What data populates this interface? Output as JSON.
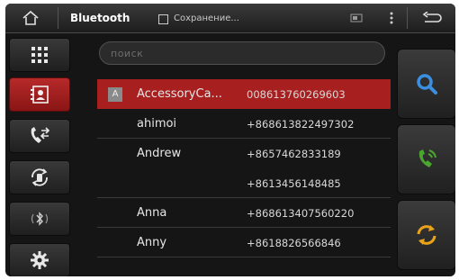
{
  "statusbar": {
    "title": "Bluetooth",
    "notification": "Сохранение..."
  },
  "icons": {
    "home": "home-icon",
    "notification": "save-icon",
    "sd": "sd-card-icon",
    "menu": "menu-dots-icon",
    "back": "back-icon"
  },
  "sidebar": {
    "items": [
      {
        "icon": "keypad-icon",
        "active": false
      },
      {
        "icon": "contacts-icon",
        "active": true
      },
      {
        "icon": "call-log-icon",
        "active": false
      },
      {
        "icon": "sync-phone-icon",
        "active": false
      },
      {
        "icon": "bluetooth-audio-icon",
        "active": false
      },
      {
        "icon": "settings-icon",
        "active": false
      }
    ]
  },
  "search": {
    "placeholder": "поиск"
  },
  "contacts": [
    {
      "letter": "A",
      "name": "AccessoryCa...",
      "number": "008613760269603",
      "selected": true
    },
    {
      "letter": "",
      "name": "ahimoi",
      "number": "+868613822497302",
      "selected": false
    },
    {
      "letter": "",
      "name": "Andrew",
      "number": "+8657462833189",
      "selected": false
    },
    {
      "letter": "",
      "name": "",
      "number": "+8613456148485",
      "selected": false
    },
    {
      "letter": "",
      "name": "Anna",
      "number": "+8686134075602​20",
      "selected": false
    },
    {
      "letter": "",
      "name": "Anny",
      "number": "+8618826566846",
      "selected": false
    }
  ],
  "actions": [
    {
      "icon": "search-icon"
    },
    {
      "icon": "call-icon"
    },
    {
      "icon": "refresh-icon"
    }
  ],
  "colors": {
    "accent": "#a81f1f",
    "search_icon": "#3a8fe0",
    "call_icon": "#4aa62e",
    "refresh_icon": "#e8a318"
  }
}
